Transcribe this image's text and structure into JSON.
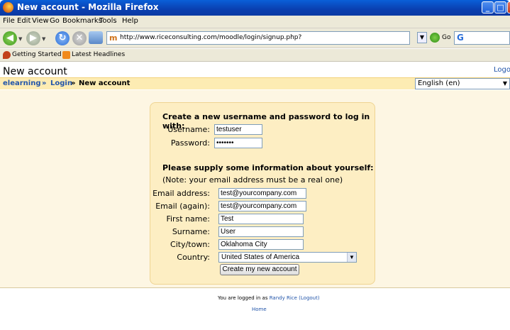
{
  "window": {
    "title": "New account - Mozilla Firefox",
    "min": "_",
    "max": "□",
    "close": "x"
  },
  "menu": [
    "File",
    "Edit",
    "View",
    "Go",
    "Bookmarks",
    "Tools",
    "Help"
  ],
  "nav": {
    "url": "http://www.riceconsulting.com/moodle/login/signup.php?",
    "go_label": "Go",
    "search_icon_text": "G",
    "moodle_icon_text": "m"
  },
  "bookmarks": [
    "Getting Started",
    "Latest Headlines"
  ],
  "page": {
    "heading": "New account",
    "logout": "Logout",
    "breadcrumb": {
      "home": "elearning",
      "sep1": "»",
      "login": "Login",
      "sep2": "»",
      "current": "New account"
    },
    "language": "English (en)"
  },
  "form": {
    "section1": "Create a new username and password to log in with:",
    "username_label": "Username:",
    "username_value": "testuser",
    "password_label": "Password:",
    "password_value": "•••••••",
    "section2": "Please supply some information about yourself:",
    "note": "(Note: your email address must be a real one)",
    "email_label": "Email address:",
    "email_value": "test@yourcompany.com",
    "email2_label": "Email (again):",
    "email2_value": "test@yourcompany.com",
    "firstname_label": "First name:",
    "firstname_value": "Test",
    "surname_label": "Surname:",
    "surname_value": "User",
    "city_label": "City/town:",
    "city_value": "Oklahoma City",
    "country_label": "Country:",
    "country_value": "United States of America",
    "submit": "Create my new account"
  },
  "footer": {
    "logged_prefix": "You are logged in as",
    "user": "Randy Rice",
    "logout": "(Logout)",
    "home": "Home"
  },
  "colors": {
    "link": "#2255aa",
    "crumbbar": "#fdecb3",
    "formbox": "#fdeec3"
  }
}
